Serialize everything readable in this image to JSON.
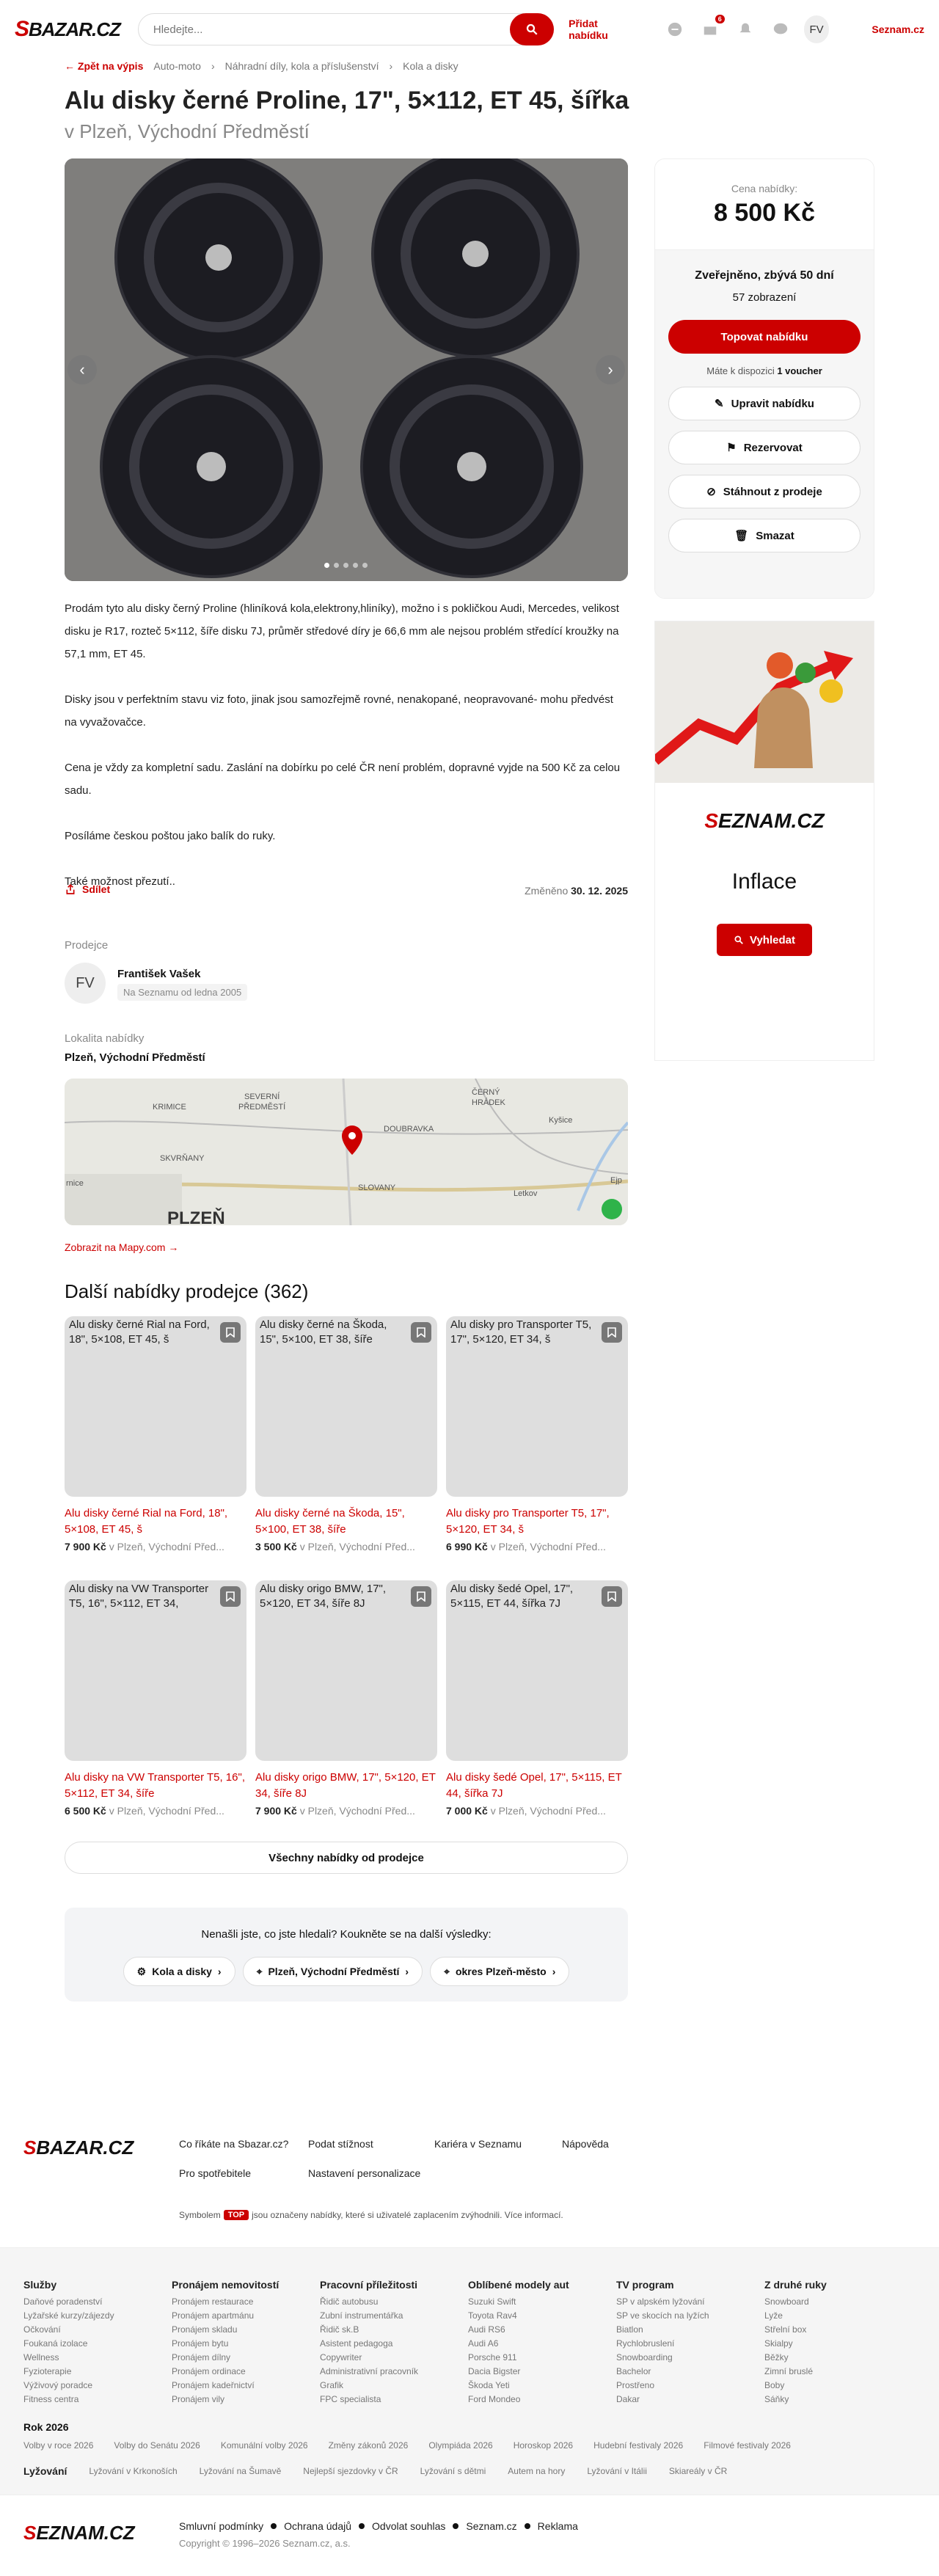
{
  "header": {
    "logo": "SBAZAR.CZ",
    "search_placeholder": "Hledejte...",
    "add_label": "Přidat nabídku",
    "mail_badge": "6",
    "avatar": "FV",
    "seznam": "Seznam.cz"
  },
  "breadcrumb": {
    "back": "Zpět na výpis",
    "items": [
      "Auto-moto",
      "Náhradní díly, kola a příslušenství",
      "Kola a disky"
    ]
  },
  "listing": {
    "title": "Alu disky černé Proline, 17\", 5×112, ET 45, šířka",
    "location": "v Plzeň, Východní Předměstí",
    "description": [
      "Prodám tyto alu disky černý Proline (hliníková kola,elektrony,hliníky), možno i s pokličkou Audi, Mercedes, velikost disku je R17, rozteč 5×112, šíře disku 7J, průměr středové díry je 66,6 mm ale nejsou problém středící kroužky na 57,1 mm, ET 45.",
      "Disky jsou v perfektním stavu viz foto, jinak jsou samozřejmě rovné, nenakopané, neopravované- mohu předvést na vyvažovačce.",
      "Cena je vždy za kompletní sadu. Zaslání na dobírku po celé ČR není problém, dopravné vyjde na 500 Kč za celou sadu.",
      "Posíláme českou poštou jako balík do ruky.",
      "Také možnost přezutí.."
    ],
    "share": "Sdílet",
    "changed_label": "Změněno",
    "changed_date": "30. 12. 2025"
  },
  "seller": {
    "heading": "Prodejce",
    "initials": "FV",
    "name": "František Vašek",
    "since": "Na Seznamu od ledna 2005"
  },
  "locality": {
    "heading": "Lokalita nabídky",
    "name": "Plzeň, Východní Předměstí",
    "map_link": "Zobrazit na Mapy.com →",
    "map_labels": {
      "krimice": "KRIMICE",
      "sever": "SEVERNÍ",
      "predmesti": "PŘEDMĚSTÍ",
      "cerny": "ČERNÝ",
      "hradek": "HRÁDEK",
      "doubravka": "DOUBRAVKA",
      "kysice": "Kyšice",
      "skvrnany": "SKVRŇANY",
      "slovany": "SLOVANY",
      "letkov": "Letkov",
      "plzen": "PLZEŇ",
      "rnice": "rnice",
      "ej": "Ejp"
    }
  },
  "more": {
    "heading": "Další nabídky prodejce (362)",
    "all_button": "Všechny nabídky od prodejce",
    "cards": [
      {
        "alt": "Alu disky černé Rial na Ford, 18\", 5×108, ET 45, š",
        "title": "Alu disky černé Rial na Ford, 18\", 5×108, ET 45, š",
        "price": "7 900 Kč",
        "loc": "v Plzeň, Východní Před..."
      },
      {
        "alt": "Alu disky černé na Škoda, 15\", 5×100, ET 38, šíře",
        "title": "Alu disky černé na Škoda, 15\", 5×100, ET 38, šíře",
        "price": "3 500 Kč",
        "loc": "v Plzeň, Východní Před..."
      },
      {
        "alt": "Alu disky pro Transporter T5, 17\", 5×120, ET 34, š",
        "title": "Alu disky pro Transporter T5, 17\", 5×120, ET 34, š",
        "price": "6 990 Kč",
        "loc": "v Plzeň, Východní Před..."
      },
      {
        "alt": "Alu disky na VW Transporter T5, 16\", 5×112, ET 34,",
        "title": "Alu disky na VW Transporter T5, 16\", 5×112, ET 34, šíře",
        "price": "6 500 Kč",
        "loc": "v Plzeň, Východní Před..."
      },
      {
        "alt": "Alu disky origo BMW, 17\", 5×120, ET 34, šíře 8J",
        "title": "Alu disky origo BMW, 17\", 5×120, ET 34, šíře 8J",
        "price": "7 900 Kč",
        "loc": "v Plzeň, Východní Před..."
      },
      {
        "alt": "Alu disky šedé Opel, 17\", 5×115, ET 44, šířka 7J",
        "title": "Alu disky šedé Opel, 17\", 5×115, ET 44, šířka 7J",
        "price": "7 000 Kč",
        "loc": "v Plzeň, Východní Před..."
      }
    ]
  },
  "found": {
    "text": "Nenašli jste, co jste hledali? Koukněte se na další výsledky:",
    "chips": [
      "Kola a disky",
      "Plzeň, Východní Předměstí",
      "okres Plzeň-město"
    ]
  },
  "sidebar": {
    "price_label": "Cena nabídky:",
    "price": "8 500 Kč",
    "status": "Zveřejněno, zbývá 50 dní",
    "views": "57 zobrazení",
    "top_button": "Topovat nabídku",
    "voucher_pre": "Máte k dispozici",
    "voucher_bold": "1 voucher",
    "edit": "Upravit nabídku",
    "reserve": "Rezervovat",
    "withdraw": "Stáhnout z prodeje",
    "delete": "Smazat"
  },
  "ad": {
    "logo": "SEZNAM.CZ",
    "word": "Inflace",
    "button": "Vyhledat"
  },
  "footer": {
    "logo": "SBAZAR.CZ",
    "links": [
      "Co říkáte na Sbazar.cz?",
      "Podat stížnost",
      "Kariéra v Seznamu",
      "Nápověda",
      "Pro spotřebitele",
      "Nastavení personalizace"
    ],
    "note_pre": "Symbolem",
    "note_badge": "TOP",
    "note_post": "jsou označeny nabídky, které si uživatelé zaplacením zvýhodnili. Více informací.",
    "cols": [
      {
        "h": "Služby",
        "items": [
          "Daňové poradenství",
          "Lyžařské kurzy/zájezdy",
          "Očkování",
          "Foukaná izolace",
          "Wellness",
          "Fyzioterapie",
          "Výživový poradce",
          "Fitness centra"
        ]
      },
      {
        "h": "Pronájem nemovitostí",
        "items": [
          "Pronájem restaurace",
          "Pronájem apartmánu",
          "Pronájem skladu",
          "Pronájem bytu",
          "Pronájem dílny",
          "Pronájem ordinace",
          "Pronájem kadeřnictví",
          "Pronájem vily"
        ]
      },
      {
        "h": "Pracovní příležitosti",
        "items": [
          "Řidič autobusu",
          "Zubní instrumentářka",
          "Řidič sk.B",
          "Asistent pedagoga",
          "Copywriter",
          "Administrativní pracovník",
          "Grafik",
          "FPC specialista"
        ]
      },
      {
        "h": "Oblíbené modely aut",
        "items": [
          "Suzuki Swift",
          "Toyota Rav4",
          "Audi RS6",
          "Audi A6",
          "Porsche 911",
          "Dacia Bigster",
          "Škoda Yeti",
          "Ford Mondeo"
        ]
      },
      {
        "h": "TV program",
        "items": [
          "SP v alpském lyžování",
          "SP ve skocích na lyžích",
          "Biatlon",
          "Rychlobruslení",
          "Snowboarding",
          "Bachelor",
          "Prostřeno",
          "Dakar"
        ]
      },
      {
        "h": "Z druhé ruky",
        "items": [
          "Snowboard",
          "Lyže",
          "Střelní box",
          "Skialpy",
          "Běžky",
          "Zimní bruslé",
          "Boby",
          "Sáňky"
        ]
      }
    ],
    "year": "Rok 2026",
    "year_items": [
      "Volby v roce 2026",
      "Volby do Senátu 2026",
      "Komunální volby 2026",
      "Změny zákonů 2026",
      "Olympiáda 2026",
      "Horoskop 2026",
      "Hudební festivaly 2026",
      "Filmové festivaly 2026"
    ],
    "ski_heading": "Lyžování",
    "ski_items": [
      "Lyžování v Krkonoších",
      "Lyžování na Šumavě",
      "Nejlepší sjezdovky v ČR",
      "Lyžování s dětmi",
      "Autem na hory",
      "Lyžování v Itálii",
      "Skiareály v ČR"
    ],
    "seznam_logo": "SEZNAM.CZ",
    "legal": [
      "Smluvní podmínky",
      "Ochrana údajů",
      "Odvolat souhlas",
      "Seznam.cz",
      "Reklama"
    ],
    "copyright": "Copyright © 1996–2026 Seznam.cz, a.s."
  }
}
